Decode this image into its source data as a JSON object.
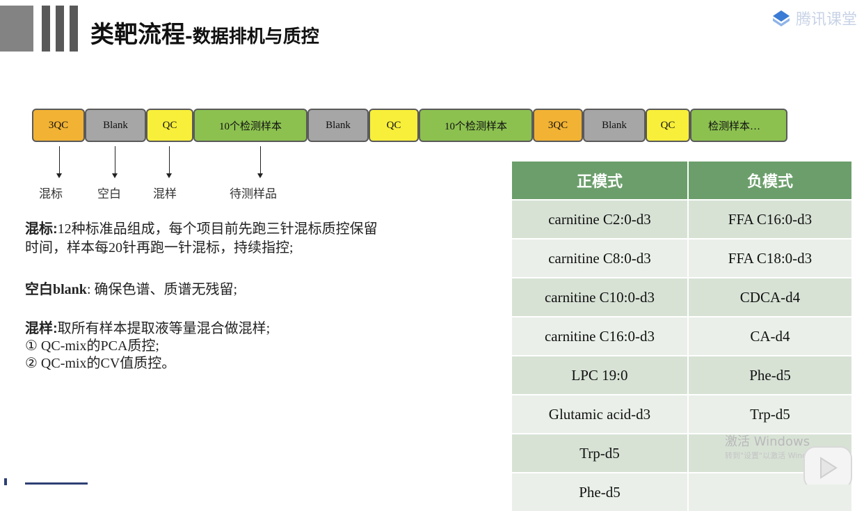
{
  "header": {
    "title_main": "类靶流程",
    "title_sub": "-数据排机与质控",
    "logo_text": "腾讯课堂"
  },
  "flow": {
    "boxes": [
      {
        "label": "3QC",
        "color": "orange"
      },
      {
        "label": "Blank",
        "color": "gray"
      },
      {
        "label": "QC",
        "color": "yellow"
      },
      {
        "label": "10个检测样本",
        "color": "green"
      },
      {
        "label": "Blank",
        "color": "gray"
      },
      {
        "label": "QC",
        "color": "yellow"
      },
      {
        "label": "10个检测样本",
        "color": "green"
      },
      {
        "label": "3QC",
        "color": "orange"
      },
      {
        "label": "Blank",
        "color": "gray"
      },
      {
        "label": "QC",
        "color": "yellow"
      },
      {
        "label": "检测样本…",
        "color": "green"
      }
    ],
    "arrow_labels": [
      "混标",
      "空白",
      "混样",
      "待测样品"
    ]
  },
  "notes": {
    "mix_label": "混标:",
    "mix_line1": "12种标准品组成，每个项目前先跑三针混标质控保留",
    "mix_line2": "时间，样本每20针再跑一针混标，持续指控;",
    "blank_label": "空白",
    "blank_label2": "blank",
    "blank_text": ": 确保色谱、质谱无残留;",
    "pool_label": "混样:",
    "pool_text": "取所有样本提取液等量混合做混样;",
    "pool_item1": "① QC-mix的PCA质控;",
    "pool_item2": "② QC-mix的CV值质控。"
  },
  "table": {
    "headers": [
      "正模式",
      "负模式"
    ],
    "rows": [
      [
        "carnitine C2:0-d3",
        "FFA C16:0-d3"
      ],
      [
        "carnitine C8:0-d3",
        "FFA C18:0-d3"
      ],
      [
        "carnitine C10:0-d3",
        "CDCA-d4"
      ],
      [
        "carnitine C16:0-d3",
        "CA-d4"
      ],
      [
        "LPC 19:0",
        "Phe-d5"
      ],
      [
        "Glutamic acid-d3",
        "Trp-d5"
      ],
      [
        "Trp-d5",
        ""
      ],
      [
        "Phe-d5",
        ""
      ]
    ]
  },
  "overlay": {
    "watermark_line1": "激活 Windows",
    "watermark_line2": "转到\"设置\"以激活 Windows。"
  }
}
